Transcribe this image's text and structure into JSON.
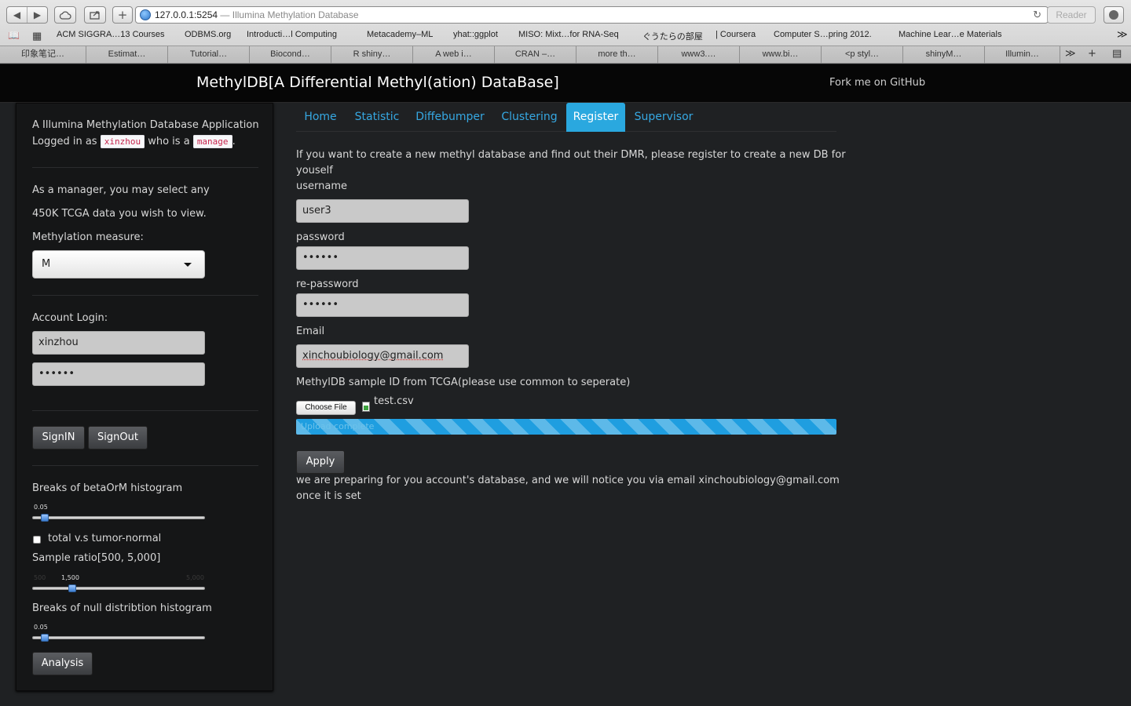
{
  "browser": {
    "nav_back": "◀",
    "nav_forward": "▶",
    "cloud_icon": "cloud-icon",
    "share_icon": "share-icon",
    "new_tab_label": "+",
    "url": "127.0.0.1:5254",
    "page_title_suffix": "— Illumina Methylation Database",
    "reload_glyph": "↻",
    "reader_label": "Reader",
    "bookmarks": [
      "ACM SIGGRA…13 Courses",
      "ODBMS.org",
      "Introducti…l Computing",
      "Metacademy–ML",
      "yhat::ggplot",
      "MISO: Mixt…for RNA-Seq",
      "ぐうたらの部屋",
      "| Coursera",
      "Computer S…pring 2012.",
      "Machine Lear…e Materials"
    ],
    "bookmarks_more": "≫",
    "tabs": [
      "印象笔记…",
      "Estimat…",
      "Tutorial…",
      "Biocond…",
      "R shiny…",
      "A web i…",
      "CRAN –…",
      "more th…",
      "www3.…",
      "www.bi…",
      "<p styl…",
      "shinyM…",
      "Illumin…"
    ],
    "tabs_more": "≫",
    "tabs_add": "+"
  },
  "header": {
    "brand": "MethylDB[A Differential Methyl(ation) DataBase]",
    "fork_link": "Fork me on GitHub"
  },
  "sidebar": {
    "app_title": "A Illumina Methylation Database Application",
    "logged_prefix": "Logged in as",
    "username": "xinzhou",
    "role_prefix": "who is a",
    "role": "manage",
    "role_suffix": ".",
    "manager_note_line1": "As a manager, you may select any",
    "manager_note_line2": "450K TCGA data you wish to view.",
    "measure_label": "Methylation measure:",
    "measure_value": "M",
    "login_label": "Account Login:",
    "login_username": "xinzhou",
    "login_password": "••••••",
    "signin_label": "SignIN",
    "signout_label": "SignOut",
    "breaks_label": "Breaks of betaOrM histogram",
    "breaks_value": "0.05",
    "breaks_fraction": 0.05,
    "checkbox_label": "total v.s tumor-normal",
    "sample_ratio_label": "Sample ratio[500, 5,000]",
    "sample_ratio_value": "1,500",
    "sample_ratio_min": "500",
    "sample_ratio_max": "5,000",
    "sample_ratio_fraction": 0.22,
    "null_breaks_label": "Breaks of null distribtion histogram",
    "null_breaks_value": "0.05",
    "null_breaks_fraction": 0.05,
    "analysis_label": "Analysis"
  },
  "main": {
    "tabs": [
      "Home",
      "Statistic",
      "Diffebumper",
      "Clustering",
      "Register",
      "Supervisor"
    ],
    "active_tab": "Register",
    "intro_line1": "If you want to create a new methyl database and find out their DMR, please register to create a new DB for",
    "intro_line2": "youself",
    "username_label": "username",
    "username_value": "user3",
    "password_label": "password",
    "password_value": "••••••",
    "repassword_label": "re-password",
    "repassword_value": "••••••",
    "email_label": "Email",
    "email_value": "xinchoubiology@gmail.com",
    "sample_id_label": "MethylDB sample ID from TCGA(please use common to seperate)",
    "choose_file_label": "Choose File",
    "file_name": "test.csv",
    "upload_status": "Upload complete",
    "upload_progress": 1.0,
    "apply_label": "Apply",
    "result_line1": "we are preparing for you account's database, and we will notice you via email xinchoubiology@gmail.com",
    "result_line2": "once it is set"
  }
}
